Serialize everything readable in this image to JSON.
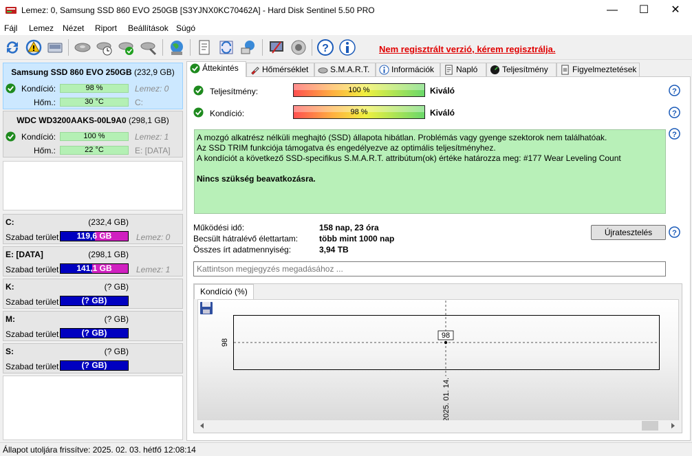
{
  "window": {
    "title": "Lemez: 0, Samsung SSD 860 EVO 250GB [S3YJNX0KC70462A]  -  Hard Disk Sentinel 5.50 PRO",
    "minimize": "—",
    "maximize": "☐",
    "close": "✕"
  },
  "menu": {
    "items": [
      "Fájl",
      "Lemez",
      "Nézet",
      "Riport",
      "Beállítások",
      "Súgó"
    ]
  },
  "toolbar": {
    "register_link": "Nem regisztrált verzió, kérem regisztrálja."
  },
  "disks": [
    {
      "name": "Samsung SSD 860 EVO 250GB",
      "size": "(232,9 GB)",
      "condition_label": "Kondíció:",
      "condition_value": "98 %",
      "condition_fraction": 0.98,
      "temp_label": "Hőm.:",
      "temp_value": "30 °C",
      "disk_ref": "Lemez: 0",
      "drive_letters": "C:"
    },
    {
      "name": "WDC WD3200AAKS-00L9A0",
      "size": "(298,1 GB)",
      "condition_label": "Kondíció:",
      "condition_value": "100 %",
      "condition_fraction": 1.0,
      "temp_label": "Hőm.:",
      "temp_value": "22 °C",
      "disk_ref": "Lemez: 1",
      "drive_letters": "E: [DATA]"
    }
  ],
  "volumes": [
    {
      "name": "C:",
      "size": "(232,4 GB)",
      "free_label": "Szabad terület",
      "free_value": "119,6 GB",
      "used_fraction": 0.49,
      "disk_ref": "Lemez: 0"
    },
    {
      "name": "E: [DATA]",
      "size": "(298,1 GB)",
      "free_label": "Szabad terület",
      "free_value": "141,1 GB",
      "used_fraction": 0.53,
      "disk_ref": "Lemez: 1"
    },
    {
      "name": "K:",
      "size": "(? GB)",
      "free_label": "Szabad terület",
      "free_value": "(? GB)",
      "used_fraction": 0,
      "disk_ref": ""
    },
    {
      "name": "M:",
      "size": "(? GB)",
      "free_label": "Szabad terület",
      "free_value": "(? GB)",
      "used_fraction": 0,
      "disk_ref": ""
    },
    {
      "name": "S:",
      "size": "(? GB)",
      "free_label": "Szabad terület",
      "free_value": "(? GB)",
      "used_fraction": 0,
      "disk_ref": ""
    }
  ],
  "tabs": [
    "Áttekintés",
    "Hőmérséklet",
    "S.M.A.R.T.",
    "Információk",
    "Napló",
    "Teljesítmény",
    "Figyelmeztetések"
  ],
  "overview": {
    "performance_label": "Teljesítmény:",
    "performance_value": "100 %",
    "performance_fraction": 1.0,
    "performance_status": "Kiváló",
    "condition_label": "Kondíció:",
    "condition_value": "98 %",
    "condition_fraction": 0.98,
    "condition_status": "Kiváló",
    "info_lines": [
      "A mozgó alkatrész nélküli meghajtó (SSD) állapota hibátlan. Problémás vagy gyenge szektorok nem találhatóak.",
      "Az SSD TRIM funkciója támogatva és engedélyezve az optimális teljesítményhez.",
      "A kondíciót a következő SSD-specifikus S.M.A.R.T. attribútum(ok) értéke határozza meg:  #177 Wear Leveling Count"
    ],
    "info_action": "Nincs szükség beavatkozásra.",
    "uptime_label": "Működési idő:",
    "uptime_value": "158 nap, 23 óra",
    "remaining_label": "Becsült hátralévő élettartam:",
    "remaining_value": "több mint 1000 nap",
    "written_label": "Összes írt adatmennyiség:",
    "written_value": "3,94 TB",
    "reset_button": "Újratesztelés",
    "note_placeholder": "Kattintson megjegyzés megadásához ..."
  },
  "chart_tab_label": "Kondíció  (%)",
  "chart_data": {
    "type": "line",
    "x": [
      "2025. 01. 14."
    ],
    "series": [
      {
        "values": [
          98
        ]
      }
    ],
    "point_labels": [
      "98"
    ],
    "ytick_labels": [
      "98"
    ],
    "xtick_labels": [
      "2025. 01. 14."
    ],
    "grid": false
  },
  "statusbar": {
    "text": "Állapot utoljára frissítve: 2025. 02. 03. hétfő 12:08:14"
  },
  "colors": {
    "selected_card": "#cce8ff",
    "condition_bar": "#b4f0b4",
    "volume_free": "#0000c0",
    "volume_used": "#d020c0",
    "info_background": "#b8f0b8",
    "register_link": "#e00000"
  }
}
